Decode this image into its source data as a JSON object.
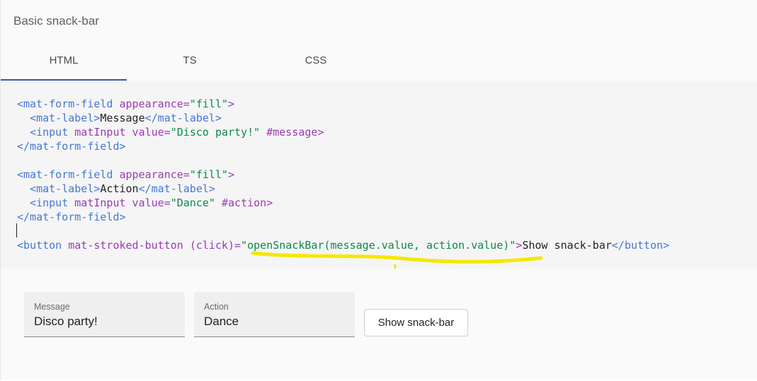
{
  "title": "Basic snack-bar",
  "tabs": [
    {
      "label": "HTML",
      "active": true
    },
    {
      "label": "TS",
      "active": false
    },
    {
      "label": "CSS",
      "active": false
    }
  ],
  "code": {
    "l1_tag": "<mat-form-field",
    "l1_attr": " appearance=",
    "l1_val": "\"fill\"",
    "l1_end": ">",
    "l2_open": "<mat-label>",
    "l2_text": "Message",
    "l2_close": "</mat-label>",
    "l3_tag": "<input",
    "l3_attr": " matInput value=",
    "l3_val": "\"Disco party!\"",
    "l3_ref": " #message>",
    "l4": "</mat-form-field>",
    "l6_tag": "<mat-form-field",
    "l6_attr": " appearance=",
    "l6_val": "\"fill\"",
    "l6_end": ">",
    "l7_open": "<mat-label>",
    "l7_text": "Action",
    "l7_close": "</mat-label>",
    "l8_tag": "<input",
    "l8_attr": " matInput value=",
    "l8_val": "\"Dance\"",
    "l8_ref": " #action>",
    "l9": "</mat-form-field>",
    "l11_tag": "<button",
    "l11_attr": " mat-stroked-button (click)=",
    "l11_q1": "\"",
    "l11_val": "openSnackBar(message.value, action.value)",
    "l11_q2": "\"",
    "l11_gt": ">",
    "l11_text": "Show snack-bar",
    "l11_close": "</button>"
  },
  "annotation_color": "#f5e800",
  "demo": {
    "message_label": "Message",
    "message_value": "Disco party!",
    "action_label": "Action",
    "action_value": "Dance",
    "button_label": "Show snack-bar"
  }
}
